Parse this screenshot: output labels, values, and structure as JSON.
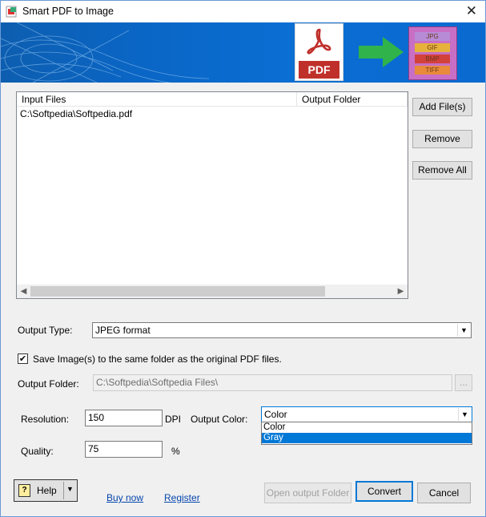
{
  "window": {
    "title": "Smart PDF to Image",
    "close_glyph": "✕"
  },
  "banner": {
    "pdf_card_label": "PDF",
    "formats": [
      "JPG",
      "GIF",
      "BMP",
      "TIFF"
    ],
    "arrow_color": "#2fb34a",
    "formats_bg": "#c86fc5"
  },
  "files": {
    "columns": [
      "Input Files",
      "Output Folder"
    ],
    "rows": [
      {
        "input": "C:\\Softpedia\\Softpedia.pdf",
        "output": ""
      }
    ]
  },
  "side_buttons": {
    "add": "Add File(s)",
    "remove": "Remove",
    "remove_all": "Remove All"
  },
  "output_type": {
    "label": "Output Type:",
    "value": "JPEG format"
  },
  "same_folder": {
    "label": "Save Image(s) to the same folder as the original PDF files.",
    "checked": true,
    "check_glyph": "✔"
  },
  "output_folder": {
    "label": "Output Folder:",
    "value": "C:\\Softpedia\\Softpedia Files\\",
    "browse": "..."
  },
  "resolution": {
    "label": "Resolution:",
    "value": "150",
    "unit": "DPI"
  },
  "output_color": {
    "label": "Output Color:",
    "value": "Color",
    "options": [
      "Color",
      "Gray"
    ],
    "highlighted": "Gray"
  },
  "quality": {
    "label": "Quality:",
    "value": "75",
    "unit": "%"
  },
  "footer": {
    "help": "Help",
    "help_icon": "?",
    "buy_now": "Buy now",
    "register": "Register",
    "open_output": "Open output Folder",
    "convert": "Convert",
    "cancel": "Cancel"
  },
  "colors": {
    "accent": "#0078d7",
    "banner_blue": "#0a66c6",
    "pdf_red": "#c0302b"
  }
}
